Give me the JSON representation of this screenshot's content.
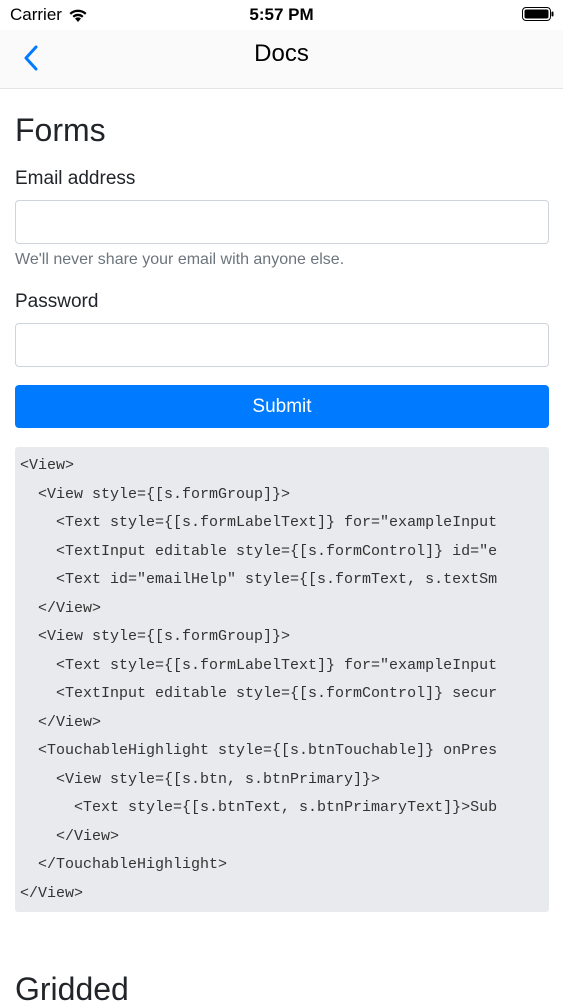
{
  "status_bar": {
    "carrier": "Carrier",
    "time": "5:57 PM"
  },
  "nav": {
    "title": "Docs",
    "back_icon": "chevron-left-icon"
  },
  "forms": {
    "title": "Forms",
    "email_label": "Email address",
    "email_value": "",
    "email_help": "We'll never share your email with anyone else.",
    "password_label": "Password",
    "password_value": "",
    "submit_label": "Submit"
  },
  "code": {
    "lines": [
      "<View>",
      "  <View style={[s.formGroup]}>",
      "    <Text style={[s.formLabelText]} for=\"exampleInput",
      "    <TextInput editable style={[s.formControl]} id=\"e",
      "    <Text id=\"emailHelp\" style={[s.formText, s.textSm",
      "  </View>",
      "  <View style={[s.formGroup]}>",
      "    <Text style={[s.formLabelText]} for=\"exampleInput",
      "    <TextInput editable style={[s.formControl]} secur",
      "  </View>",
      "  <TouchableHighlight style={[s.btnTouchable]} onPres",
      "    <View style={[s.btn, s.btnPrimary]}>",
      "      <Text style={[s.btnText, s.btnPrimaryText]}>Sub",
      "    </View>",
      "  </TouchableHighlight>",
      "</View>"
    ]
  },
  "gridded": {
    "title": "Gridded"
  },
  "colors": {
    "accent": "#007bff",
    "code_bg": "#e9eaed",
    "help_text": "#6c757d"
  }
}
